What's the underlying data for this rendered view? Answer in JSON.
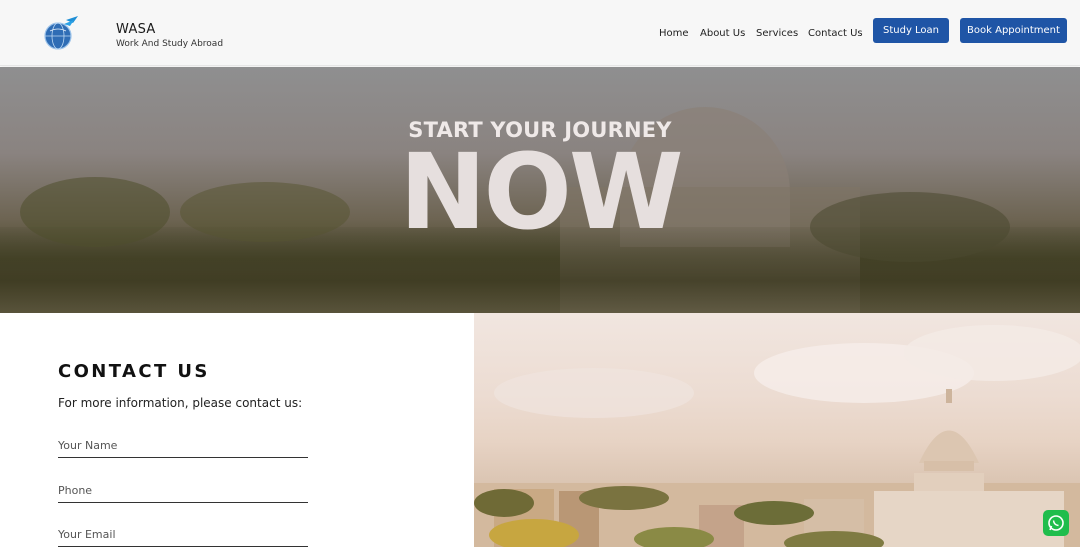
{
  "header": {
    "brand_title": "WASA",
    "brand_subtitle": "Work And Study Abroad",
    "nav": [
      "Home",
      "About Us",
      "Services",
      "Contact Us"
    ],
    "buttons": {
      "study_loan": "Study Loan",
      "book_appointment": "Book Appointment"
    }
  },
  "hero": {
    "small_title": "START YOUR JOURNEY",
    "big_title": "NOW"
  },
  "contact": {
    "title": "CONTACT US",
    "subtitle": "For more information, please contact us:",
    "fields": {
      "name_placeholder": "Your Name",
      "phone_placeholder": "Phone",
      "email_placeholder": "Your Email"
    }
  },
  "colors": {
    "accent": "#1f55a6",
    "whatsapp": "#1fbd4c"
  },
  "icons": {
    "logo": "globe-plane-icon",
    "whatsapp": "whatsapp-icon"
  }
}
